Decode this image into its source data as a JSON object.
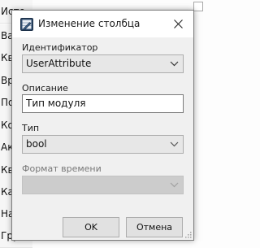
{
  "background": {
    "rows": [
      "Исто",
      "Важн",
      "Квит",
      "Врем",
      "Поль",
      "Комм",
      "Акти",
      "Квит",
      "Кач",
      "Нач",
      "Груп"
    ]
  },
  "dialog": {
    "title": "Изменение столбца",
    "close_icon": "close-icon",
    "app_icon": "edit-table-icon",
    "identifier": {
      "label": "Идентификатор",
      "value": "UserAttribute"
    },
    "description": {
      "label": "Описание",
      "value": "Тип модуля"
    },
    "type": {
      "label": "Тип",
      "value": "bool"
    },
    "time_format": {
      "label": "Формат времени",
      "value": ""
    },
    "ok_label": "OK",
    "cancel_label": "Отмена"
  },
  "colors": {
    "dialog_body": "#f0f0f0",
    "button_face": "#e1e1e1",
    "border": "#7d7d7d"
  }
}
